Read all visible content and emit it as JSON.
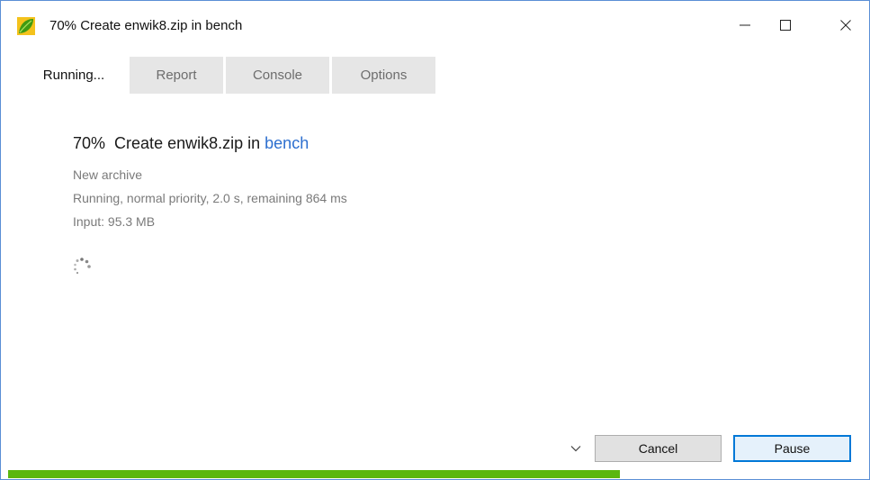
{
  "window": {
    "title": "70% Create enwik8.zip in bench",
    "icon": "green-leaf-icon",
    "controls": [
      "minimize-icon",
      "maximize-icon",
      "close-icon"
    ]
  },
  "tabs": [
    {
      "label": "Running...",
      "active": true
    },
    {
      "label": "Report",
      "active": false
    },
    {
      "label": "Console",
      "active": false
    },
    {
      "label": "Options",
      "active": false
    }
  ],
  "task": {
    "percent_label": "70%",
    "action": "Create enwik8.zip in",
    "folder_link": "bench",
    "details": [
      "New archive",
      "Running, normal priority, 2.0 s, remaining 864 ms",
      "Input: 95.3 MB"
    ]
  },
  "footer": {
    "cancel_label": "Cancel",
    "pause_label": "Pause",
    "progress_fraction": 0.716
  },
  "colors": {
    "accent": "#0078d7",
    "link": "#2d6fcf",
    "progress": "#5ab70f"
  }
}
